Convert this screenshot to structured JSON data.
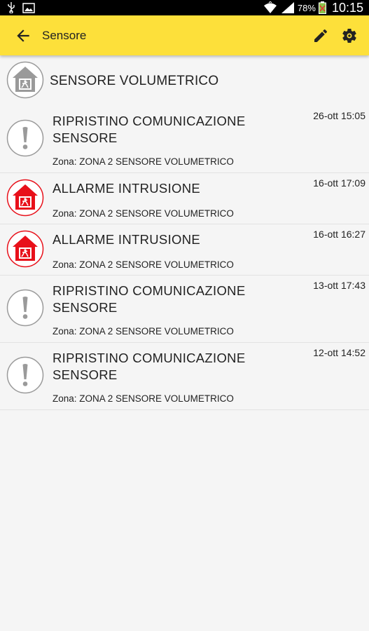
{
  "status_bar": {
    "battery_percent": "78%",
    "time": "10:15",
    "icons": [
      "usb-icon",
      "image-icon",
      "wifi-icon",
      "signal-icon",
      "battery-icon"
    ]
  },
  "app_bar": {
    "title": "Sensore",
    "actions": [
      "back-arrow-icon",
      "edit-pencil-icon",
      "settings-gear-icon"
    ],
    "color": "#fde03a"
  },
  "device": {
    "name": "SENSORE VOLUMETRICO",
    "icon": "house-sensor-icon"
  },
  "events": [
    {
      "title": "RIPRISTINO COMUNICAZIONE SENSORE",
      "time": "26-ott 15:05",
      "zone": "Zona: ZONA 2  SENSORE VOLUMETRICO",
      "icon": "exclamation-icon"
    },
    {
      "title": "ALLARME INTRUSIONE",
      "time": "16-ott 17:09",
      "zone": "Zona: ZONA 2  SENSORE VOLUMETRICO",
      "icon": "intrusion-alarm-icon"
    },
    {
      "title": "ALLARME INTRUSIONE",
      "time": "16-ott 16:27",
      "zone": "Zona: ZONA 2  SENSORE VOLUMETRICO",
      "icon": "intrusion-alarm-icon"
    },
    {
      "title": "RIPRISTINO COMUNICAZIONE SENSORE",
      "time": "13-ott 17:43",
      "zone": "Zona: ZONA 2  SENSORE VOLUMETRICO",
      "icon": "exclamation-icon"
    },
    {
      "title": "RIPRISTINO COMUNICAZIONE SENSORE",
      "time": "12-ott 14:52",
      "zone": "Zona: ZONA 2  SENSORE VOLUMETRICO",
      "icon": "exclamation-icon"
    }
  ],
  "colors": {
    "alarm_red": "#e8101a",
    "icon_gray": "#9a9a9a"
  }
}
